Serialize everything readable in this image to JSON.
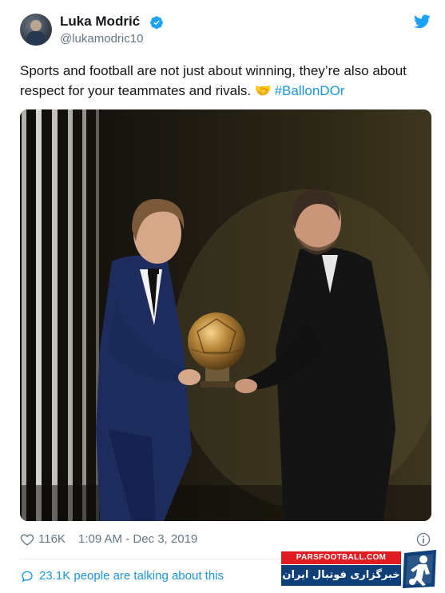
{
  "tweet": {
    "author": {
      "display_name": "Luka Modrić",
      "handle": "@lukamodric10",
      "verified": true
    },
    "text_main": "Sports and football are not just about winning, they’re also about respect for your teammates and rivals.",
    "emoji": "handshake",
    "hashtag": "#BallonDOr",
    "likes": "116K",
    "timestamp": "1:09 AM - Dec 3, 2019",
    "talking": "23.1K people are talking about this"
  },
  "watermark": {
    "site": "PARSFOOTBALL.COM",
    "tagline": "خبرگزاری فوتبال ایران"
  },
  "colors": {
    "link": "#1b95e0",
    "muted": "#657786",
    "text": "#14171a",
    "watermark_red": "#e11b22",
    "watermark_blue": "#0e3f78"
  }
}
